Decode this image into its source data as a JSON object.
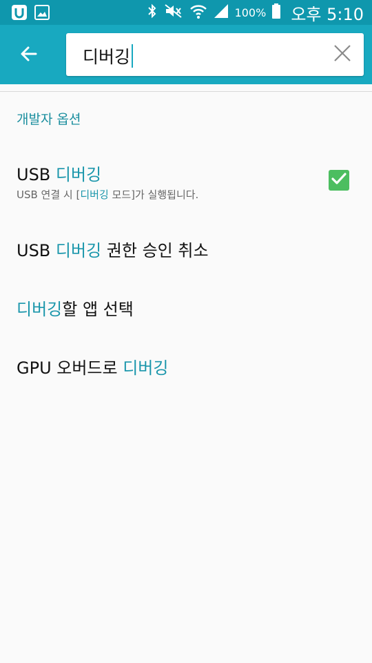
{
  "status_bar": {
    "battery_percent": "100%",
    "time": "오후 5:10",
    "icons": [
      "app-u-icon",
      "image-icon",
      "bluetooth-icon",
      "mute-icon",
      "wifi-icon",
      "signal-icon",
      "battery-icon"
    ]
  },
  "app_bar": {
    "search_value": "디버깅",
    "back_icon": "arrow-left-icon",
    "clear_icon": "close-icon"
  },
  "section": {
    "header": "개발자 옵션"
  },
  "items": [
    {
      "title_pre": "USB ",
      "title_hl": "디버깅",
      "title_post": "",
      "sub_pre": "USB 연결 시 [",
      "sub_hl": "디버깅",
      "sub_post": " 모드]가 실행됩니다.",
      "checked": true
    },
    {
      "title_pre": "USB ",
      "title_hl": "디버깅",
      "title_post": " 권한 승인 취소"
    },
    {
      "title_pre": "",
      "title_hl": "디버깅",
      "title_post": "할 앱 선택"
    },
    {
      "title_pre": "GPU 오버드로 ",
      "title_hl": "디버깅",
      "title_post": ""
    }
  ],
  "colors": {
    "status_bar": "#0f97ad",
    "app_bar": "#18a9c0",
    "highlight": "#1a96ab",
    "checkbox": "#4cbe60"
  }
}
